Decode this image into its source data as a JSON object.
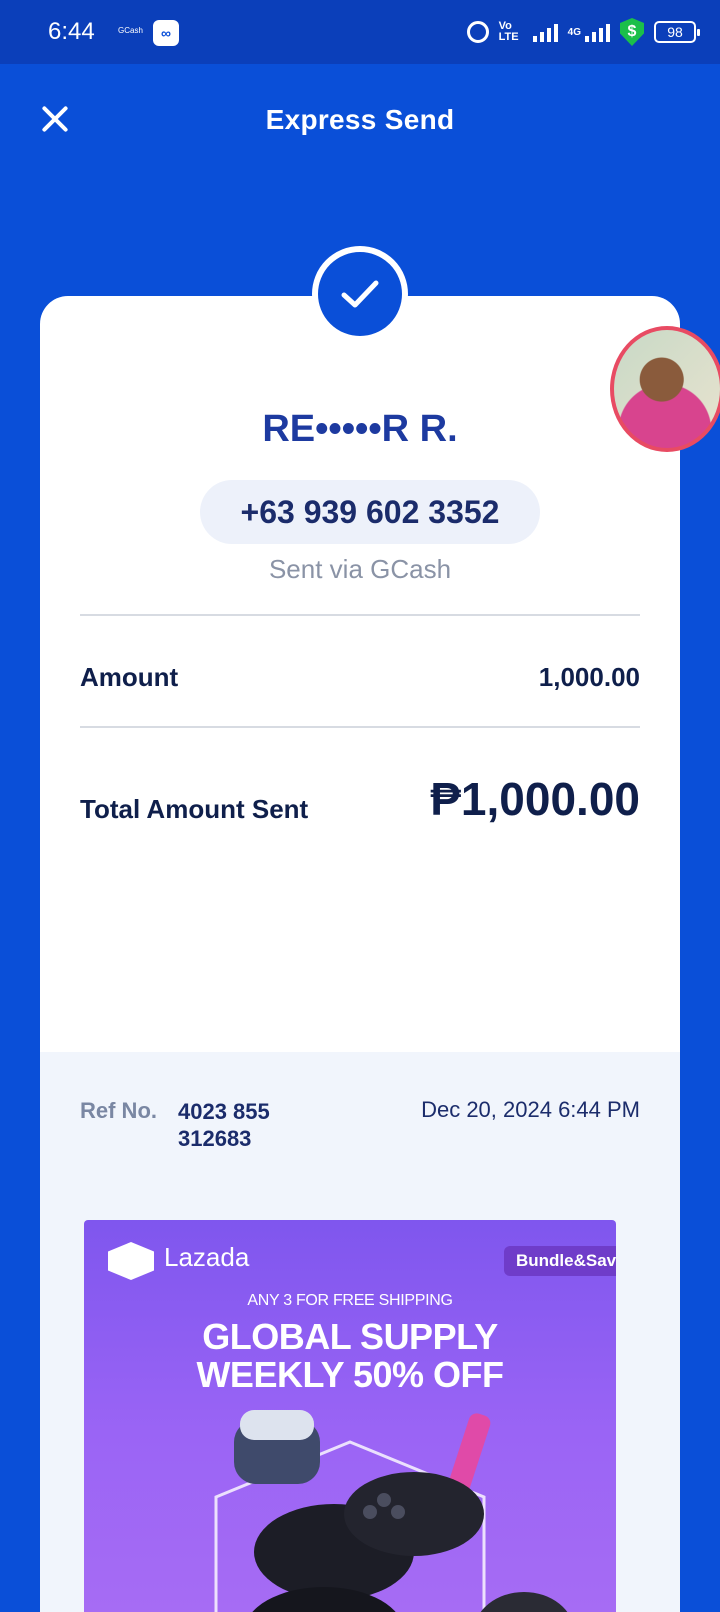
{
  "status_bar": {
    "time": "6:44",
    "app_label": "GCash",
    "network_4g": "4G",
    "volte": "Vo LTE",
    "battery": "98",
    "icons": [
      "gcash-app-icon",
      "alarm-icon",
      "volte-icon",
      "signal-icon",
      "signal-4g-icon",
      "security-shield-icon",
      "battery-icon"
    ]
  },
  "header": {
    "title": "Express Send",
    "close_icon": "close-icon"
  },
  "receipt": {
    "status_icon": "checkmark-icon",
    "recipient_name": "RE•••••R R.",
    "recipient_phone": "+63 939 602 3352",
    "sent_via": "Sent via GCash",
    "amount_label": "Amount",
    "amount_value": "1,000.00",
    "total_label": "Total Amount Sent",
    "total_value": "₱1,000.00",
    "ref_label": "Ref No.",
    "ref_number": "4023 855 312683",
    "datetime": "Dec 20, 2024 6:44 PM"
  },
  "ad": {
    "brand": "Lazada",
    "badge": "Bundle&Save",
    "tagline": "ANY 3 FOR FREE SHIPPING",
    "headline_line1": "GLOBAL SUPPLY",
    "headline_line2": "WEEKLY 50% OFF"
  },
  "colors": {
    "brand_blue": "#0a4fd8",
    "status_bar": "#0b3fba",
    "text_dark": "#0f1f4b",
    "ad_purple": "#8c5cf0"
  }
}
